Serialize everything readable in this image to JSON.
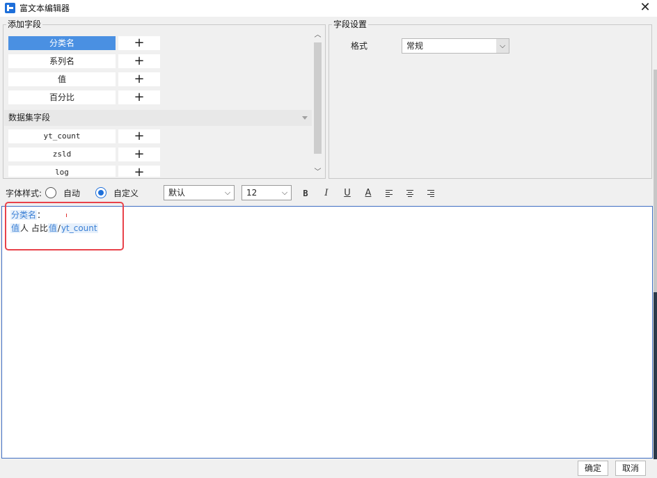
{
  "window": {
    "title": "富文本编辑器",
    "close_glyph": "✕",
    "icon": "app-logo-icon"
  },
  "add_fields": {
    "group_title": "添加字段",
    "add_glyph": "+",
    "base_fields": [
      {
        "label": "分类名",
        "selected": true
      },
      {
        "label": "系列名",
        "selected": false
      },
      {
        "label": "值",
        "selected": false
      },
      {
        "label": "百分比",
        "selected": false
      }
    ],
    "dataset_section": {
      "label": "数据集字段"
    },
    "dataset_fields": [
      {
        "label": "yt_count"
      },
      {
        "label": "zsld"
      },
      {
        "label": "log"
      }
    ],
    "scroll_up_glyph": "︿",
    "scroll_down_glyph": "﹀"
  },
  "field_settings": {
    "group_title": "字段设置",
    "format_label": "格式",
    "format_value": "常规",
    "arrow_glyph": "⌵"
  },
  "style_bar": {
    "label": "字体样式:",
    "auto_label": "自动",
    "custom_label": "自定义",
    "selected": "custom",
    "font_value": "默认",
    "size_value": "12",
    "bold_glyph": "B",
    "italic_glyph": "I",
    "underline_glyph": "U",
    "color_glyph": "A"
  },
  "editor": {
    "line1": {
      "token": "分类名",
      "suffix": "："
    },
    "line2": {
      "token1": "值",
      "text1": "人",
      "text2": "占比",
      "token2": "值",
      "slash": "/",
      "token3": "yt_count"
    }
  },
  "buttons": {
    "ok": "确定",
    "cancel": "取消"
  },
  "colors": {
    "accent": "#4a90e2",
    "token_text": "#3a7fd5",
    "highlight": "#e8424a"
  }
}
